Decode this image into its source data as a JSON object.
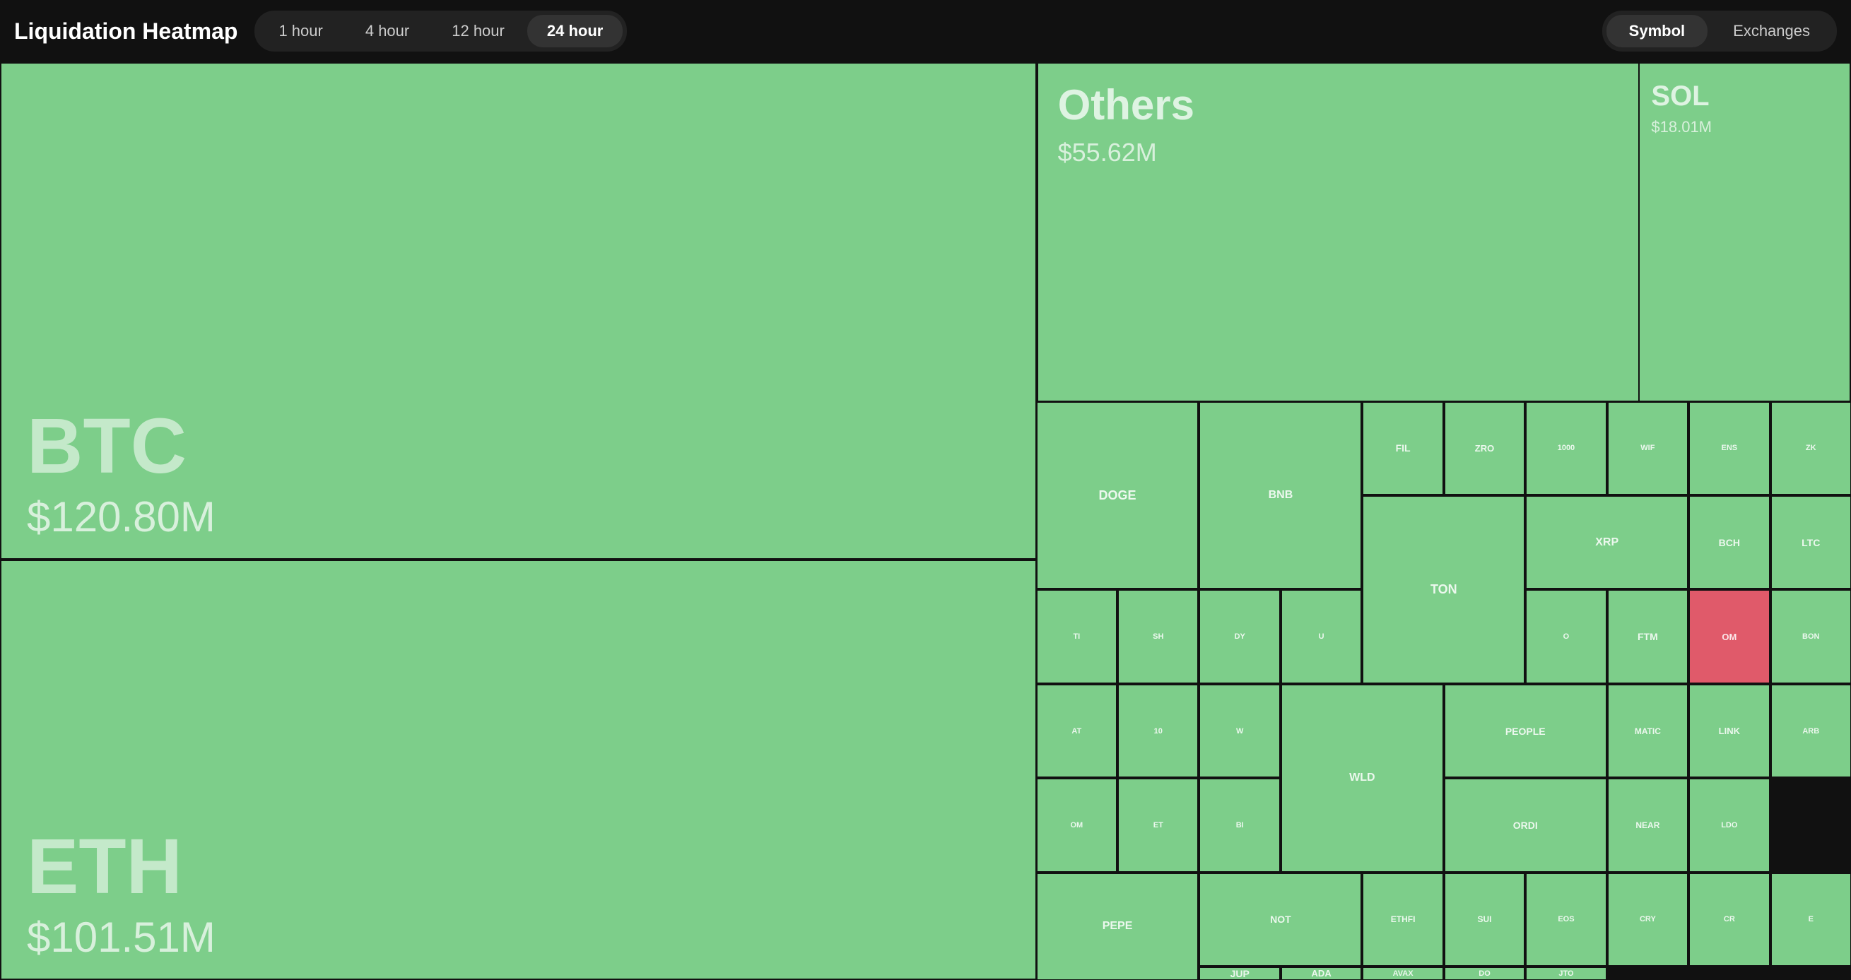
{
  "header": {
    "title": "Liquidation Heatmap",
    "timeTabs": [
      {
        "label": "1 hour",
        "id": "1h",
        "active": false
      },
      {
        "label": "4 hour",
        "id": "4h",
        "active": false
      },
      {
        "label": "12 hour",
        "id": "12h",
        "active": false
      },
      {
        "label": "24 hour",
        "id": "24h",
        "active": true
      }
    ],
    "rightTabs": [
      {
        "label": "Symbol",
        "id": "symbol",
        "active": true
      },
      {
        "label": "Exchanges",
        "id": "exchanges",
        "active": false
      }
    ]
  },
  "heatmap": {
    "btc": {
      "symbol": "BTC",
      "value": "$120.80M"
    },
    "eth": {
      "symbol": "ETH",
      "value": "$101.51M"
    },
    "others": {
      "label": "Others",
      "value": "$55.62M"
    },
    "sol": {
      "label": "SOL",
      "value": "$18.01M"
    },
    "gridCells": [
      {
        "id": "doge",
        "label": "DOGE",
        "color": "green",
        "size": "large"
      },
      {
        "id": "bnb",
        "label": "BNB",
        "color": "green",
        "size": "large"
      },
      {
        "id": "fil",
        "label": "FIL",
        "color": "green"
      },
      {
        "id": "zro",
        "label": "ZRO",
        "color": "green"
      },
      {
        "id": "1000",
        "label": "1000",
        "color": "green"
      },
      {
        "id": "wif",
        "label": "WIF",
        "color": "green"
      },
      {
        "id": "ens",
        "label": "ENS",
        "color": "green"
      },
      {
        "id": "zk",
        "label": "ZK",
        "color": "green"
      },
      {
        "id": "ton",
        "label": "TON",
        "color": "green",
        "size": "large"
      },
      {
        "id": "xrp",
        "label": "XRP",
        "color": "green"
      },
      {
        "id": "bch",
        "label": "BCH",
        "color": "green"
      },
      {
        "id": "ltc",
        "label": "LTC",
        "color": "green"
      },
      {
        "id": "ti",
        "label": "TI",
        "color": "green"
      },
      {
        "id": "sh",
        "label": "SH",
        "color": "green"
      },
      {
        "id": "dy",
        "label": "DY",
        "color": "green"
      },
      {
        "id": "u",
        "label": "U",
        "color": "green"
      },
      {
        "id": "o",
        "label": "O",
        "color": "green"
      },
      {
        "id": "ftm",
        "label": "FTM",
        "color": "green"
      },
      {
        "id": "om",
        "label": "OM",
        "color": "red"
      },
      {
        "id": "bon",
        "label": "BON",
        "color": "green"
      },
      {
        "id": "at",
        "label": "AT",
        "color": "green"
      },
      {
        "id": "10",
        "label": "10",
        "color": "green"
      },
      {
        "id": "w",
        "label": "W",
        "color": "green"
      },
      {
        "id": "wld",
        "label": "WLD",
        "color": "green",
        "size": "large"
      },
      {
        "id": "people",
        "label": "PEOPLE",
        "color": "green"
      },
      {
        "id": "matic",
        "label": "MATIC",
        "color": "green"
      },
      {
        "id": "link",
        "label": "LINK",
        "color": "green"
      },
      {
        "id": "arb",
        "label": "ARB",
        "color": "green"
      },
      {
        "id": "om2",
        "label": "OM",
        "color": "green"
      },
      {
        "id": "et",
        "label": "ET",
        "color": "green"
      },
      {
        "id": "bi",
        "label": "BI",
        "color": "green"
      },
      {
        "id": "ordi",
        "label": "ORDI",
        "color": "green"
      },
      {
        "id": "near",
        "label": "NEAR",
        "color": "green"
      },
      {
        "id": "ldo",
        "label": "LDO",
        "color": "green"
      },
      {
        "id": "pepe",
        "label": "PEPE",
        "color": "green",
        "size": "large"
      },
      {
        "id": "not",
        "label": "NOT",
        "color": "green"
      },
      {
        "id": "ethfi",
        "label": "ETHFI",
        "color": "green"
      },
      {
        "id": "sui",
        "label": "SUI",
        "color": "green"
      },
      {
        "id": "eos",
        "label": "EOS",
        "color": "green"
      },
      {
        "id": "cry",
        "label": "CRY",
        "color": "green"
      },
      {
        "id": "cr",
        "label": "CR",
        "color": "green"
      },
      {
        "id": "e",
        "label": "E",
        "color": "green"
      },
      {
        "id": "jup",
        "label": "JUP",
        "color": "green"
      },
      {
        "id": "ada",
        "label": "ADA",
        "color": "green"
      },
      {
        "id": "avax",
        "label": "AVAX",
        "color": "green"
      },
      {
        "id": "do",
        "label": "DO",
        "color": "green"
      },
      {
        "id": "jto",
        "label": "JTO",
        "color": "green"
      }
    ]
  }
}
